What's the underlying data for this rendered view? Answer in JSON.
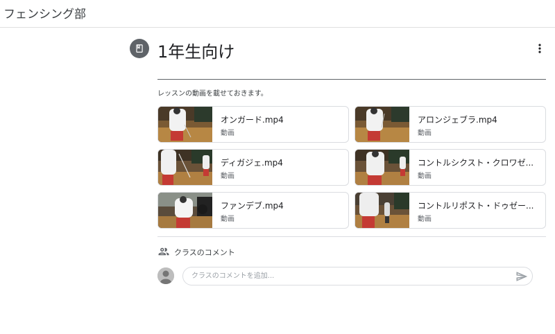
{
  "header": {
    "class_name": "フェンシング部"
  },
  "post": {
    "icon": "book-icon",
    "title": "1年生向け",
    "menu_icon": "more-vert-icon",
    "description": "レッスンの動画を載せておきます。"
  },
  "attachments": [
    {
      "name": "オンガード.mp4",
      "type": "動画"
    },
    {
      "name": "アロンジェブラ.mp4",
      "type": "動画"
    },
    {
      "name": "ディガジェ.mp4",
      "type": "動画"
    },
    {
      "name": "コントルシクスト・クロワゼ...",
      "type": "動画"
    },
    {
      "name": "ファンデブ.mp4",
      "type": "動画"
    },
    {
      "name": "コントルリポスト・ドゥゼー...",
      "type": "動画"
    }
  ],
  "comments": {
    "icon": "people-icon",
    "label": "クラスのコメント",
    "placeholder": "クラスのコメントを追加...",
    "send_icon": "send-icon"
  }
}
